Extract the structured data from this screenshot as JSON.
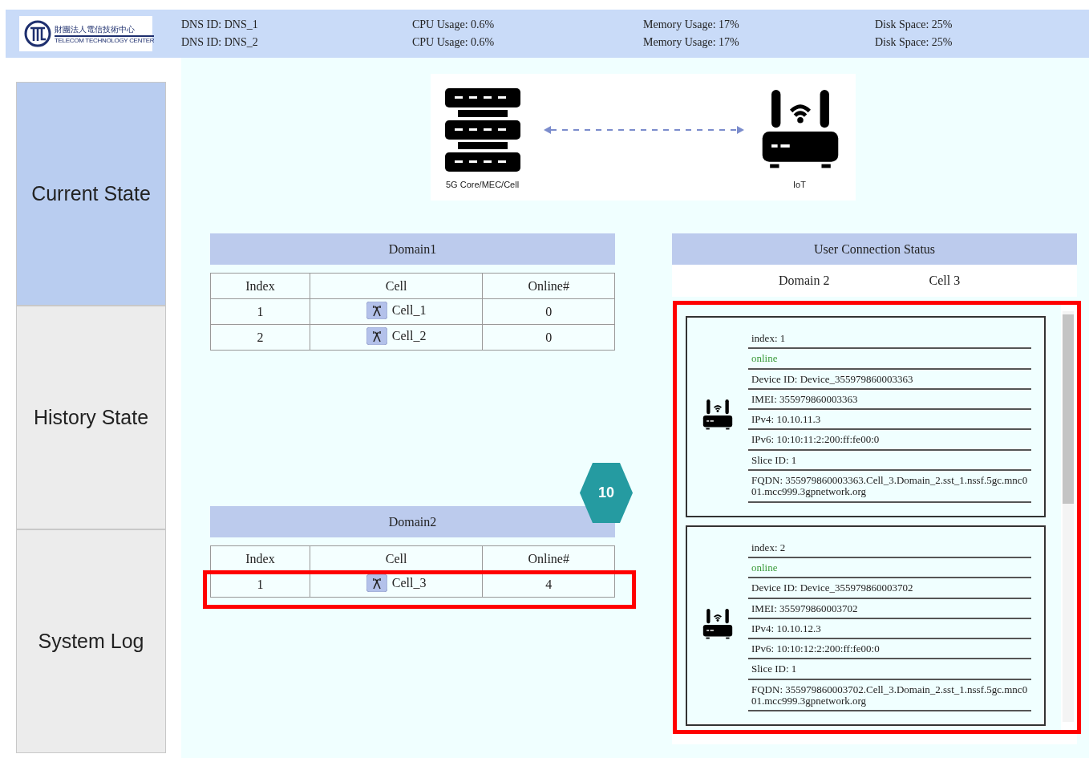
{
  "header": {
    "logo": {
      "chinese": "財團法人電信技術中心",
      "english": "TELECOM TECHNOLOGY CENTER"
    },
    "rows": [
      [
        "DNS ID: DNS_1",
        "CPU Usage: 0.6%",
        "Memory Usage: 17%",
        "Disk Space: 25%"
      ],
      [
        "DNS ID: DNS_2",
        "CPU Usage: 0.6%",
        "Memory Usage: 17%",
        "Disk Space: 25%"
      ]
    ]
  },
  "sidebar": {
    "items": [
      {
        "label": "Current State",
        "selected": true
      },
      {
        "label": "History State",
        "selected": false
      },
      {
        "label": "System Log",
        "selected": false
      }
    ]
  },
  "diagram": {
    "left_label": "5G Core/MEC/Cell",
    "right_label": "IoT"
  },
  "domains": [
    {
      "title": "Domain1",
      "columns": [
        "Index",
        "Cell",
        "Online#"
      ],
      "rows": [
        [
          "1",
          "Cell_1",
          "0"
        ],
        [
          "2",
          "Cell_2",
          "0"
        ]
      ]
    },
    {
      "title": "Domain2",
      "columns": [
        "Index",
        "Cell",
        "Online#"
      ],
      "rows": [
        [
          "1",
          "Cell_3",
          "4"
        ]
      ]
    }
  ],
  "connection": {
    "title": "User Connection Status",
    "domain": "Domain 2",
    "cell": "Cell 3",
    "devices": [
      {
        "index": "index: 1",
        "status": {
          "text": "online",
          "kind": "online"
        },
        "fields": [
          "Device ID: Device_355979860003363",
          "IMEI: 355979860003363",
          "IPv4: 10.10.11.3",
          "IPv6: 10:10:11:2:200:ff:fe00:0",
          "Slice ID: 1",
          "FQDN: 355979860003363.Cell_3.Domain_2.sst_1.nssf.5gc.mnc001.mcc999.3gpnetwork.org"
        ]
      },
      {
        "index": "index: 2",
        "status": {
          "text": "online",
          "kind": "online"
        },
        "fields": [
          "Device ID: Device_355979860003702",
          "IMEI: 355979860003702",
          "IPv4: 10.10.12.3",
          "IPv6: 10:10:12:2:200:ff:fe00:0",
          "Slice ID: 1",
          "FQDN: 355979860003702.Cell_3.Domain_2.sst_1.nssf.5gc.mnc001.mcc999.3gpnetwork.org"
        ]
      }
    ]
  },
  "callout": {
    "label": "10"
  }
}
